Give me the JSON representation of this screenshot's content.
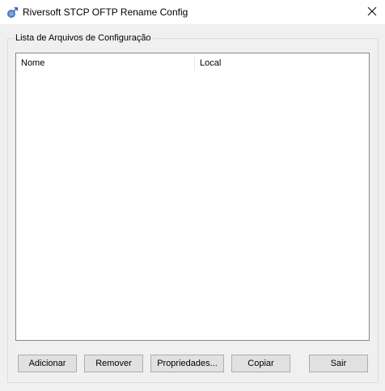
{
  "window": {
    "title": "Riversoft STCP OFTP Rename Config",
    "app_icon": "app-logo-icon",
    "close_icon": "close-icon",
    "close_glyph": "✕"
  },
  "group": {
    "label": "Lista de Arquivos de Configuração"
  },
  "list": {
    "columns": [
      "Nome",
      "Local"
    ],
    "rows": []
  },
  "buttons": {
    "add": "Adicionar",
    "remove": "Remover",
    "properties": "Propriedades...",
    "copy": "Copiar",
    "exit": "Sair"
  },
  "colors": {
    "window_bg": "#f0f0f0",
    "titlebar_bg": "#ffffff",
    "list_bg": "#ffffff",
    "button_bg": "#e1e1e1",
    "button_border": "#adadad"
  }
}
